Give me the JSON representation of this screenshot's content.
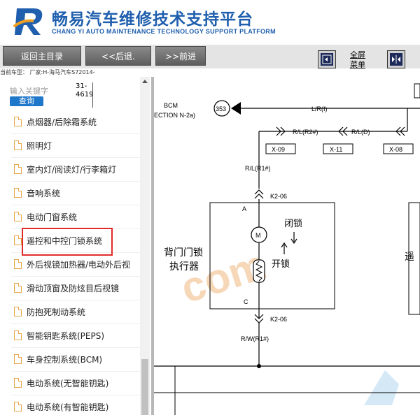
{
  "header": {
    "title": "畅易汽车维修技术支持平台",
    "subtitle": "CHANG YI AUTO MAINTENANCE TECHNOLOGY SUPPORT PLATFORM"
  },
  "toolbar": {
    "home_label": "返回主目录",
    "back_label": "<<后退.",
    "forward_label": ">>前进",
    "fullscreen_line1": "全屏",
    "fullscreen_line2": "菜单"
  },
  "model_bar": "当前车型： 厂家:H-海马汽车S72014-",
  "sidebar": {
    "search_placeholder": "输入关键字",
    "query_label": "查询",
    "search_code_1": "31-",
    "search_code_2": "4619",
    "items": [
      {
        "label": "点烟器/后除霜系统"
      },
      {
        "label": "照明灯"
      },
      {
        "label": "室内灯/阅读灯/行李箱灯"
      },
      {
        "label": "音响系统"
      },
      {
        "label": "电动门窗系统"
      },
      {
        "label": "遥控和中控门锁系统"
      },
      {
        "label": "外后视镜加热器/电动外后视"
      },
      {
        "label": "滑动顶窗及防炫目后视镜"
      },
      {
        "label": "防抱死制动系统"
      },
      {
        "label": "智能钥匙系统(PEPS)"
      },
      {
        "label": "车身控制系统(BCM)"
      },
      {
        "label": "电动系统(无智能钥匙)"
      },
      {
        "label": "电动系统(有智能钥匙)"
      }
    ]
  },
  "diagram": {
    "bcm_label": "BCM",
    "section_label": "ECTION N-2a)",
    "node_353": "353",
    "wire_lr_i": "L/R(I)",
    "wire_rl_r2": "R/L(R2#)",
    "wire_rl_d": "R/L(D)",
    "conn_x09": "X-09",
    "conn_x11": "X-11",
    "conn_x08": "X-08",
    "wire_rl_r1": "R/L(R1#)",
    "k2_top": "K2-06",
    "pin_a": "A",
    "lock_label": "闭锁",
    "unlock_label": "开锁",
    "actuator_1": "背门门锁",
    "actuator_2": "执行器",
    "pin_c": "C",
    "k2_bottom": "K2-06",
    "wire_rw_r1": "R/W(R1#)",
    "right_cut": "遥",
    "watermark": "com"
  }
}
